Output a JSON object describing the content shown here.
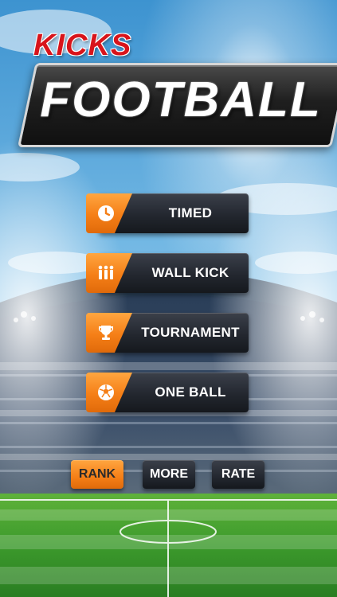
{
  "logo": {
    "top_text": "KICKS",
    "main_text": "FOOTBALL"
  },
  "menu": [
    {
      "label": "TIMED",
      "icon": "clock-icon"
    },
    {
      "label": "WALL KICK",
      "icon": "players-wall-icon"
    },
    {
      "label": "TOURNAMENT",
      "icon": "trophy-icon"
    },
    {
      "label": "ONE BALL",
      "icon": "soccer-ball-icon"
    }
  ],
  "bottom_buttons": {
    "rank": "RANK",
    "more": "MORE",
    "rate": "RATE"
  },
  "colors": {
    "accent_orange": "#f57f17",
    "button_dark": "#23272f",
    "logo_red": "#d8141b",
    "pitch_green": "#3c9a2c",
    "sky_blue": "#4aa0d8"
  }
}
